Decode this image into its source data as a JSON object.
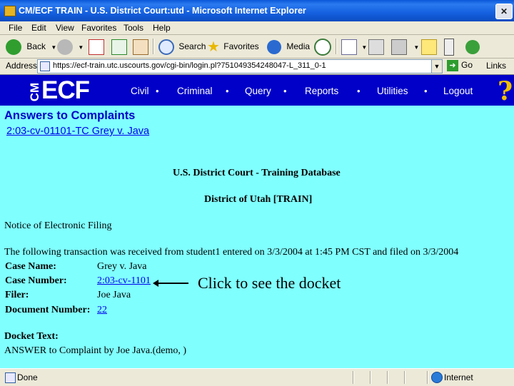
{
  "window": {
    "title": "CM/ECF TRAIN - U.S. District Court:utd - Microsoft Internet Explorer"
  },
  "menu": [
    "File",
    "Edit",
    "View",
    "Favorites",
    "Tools",
    "Help"
  ],
  "toolbar": {
    "back": "Back",
    "search": "Search",
    "favorites": "Favorites",
    "media": "Media"
  },
  "address": {
    "label": "Address",
    "url": "https://ecf-train.utc.uscourts.gov/cgi-bin/login.pl?751049354248047-L_311_0-1",
    "go": "Go",
    "links": "Links"
  },
  "ecf": {
    "logo_small": "CM",
    "logo_big": "ECF",
    "nav": [
      "Civil",
      "Criminal",
      "Query",
      "Reports",
      "Utilities",
      "Logout"
    ],
    "help": "?"
  },
  "content": {
    "title": "Answers to Complaints",
    "case_link": "2:03-cv-01101-TC Grey v. Java",
    "court": "U.S. District Court - Training Database",
    "district": "District of Utah [TRAIN]",
    "notice": "Notice of Electronic Filing",
    "transaction": "The following transaction was received from student1 entered on 3/3/2004 at 1:45 PM CST and filed on 3/3/2004",
    "fields": [
      {
        "label": "Case Name:",
        "value": "Grey v. Java"
      },
      {
        "label": "Case Number:",
        "value": "2:03-cv-1101"
      },
      {
        "label": "Filer:",
        "value": "Joe Java"
      },
      {
        "label": "Document Number:",
        "value": "22"
      }
    ],
    "annotation": "Click to see the docket",
    "docket_label": "Docket Text:",
    "docket_text": "ANSWER to Complaint by Joe Java.(demo, )"
  },
  "status": {
    "text": "Done",
    "zone": "Internet"
  }
}
